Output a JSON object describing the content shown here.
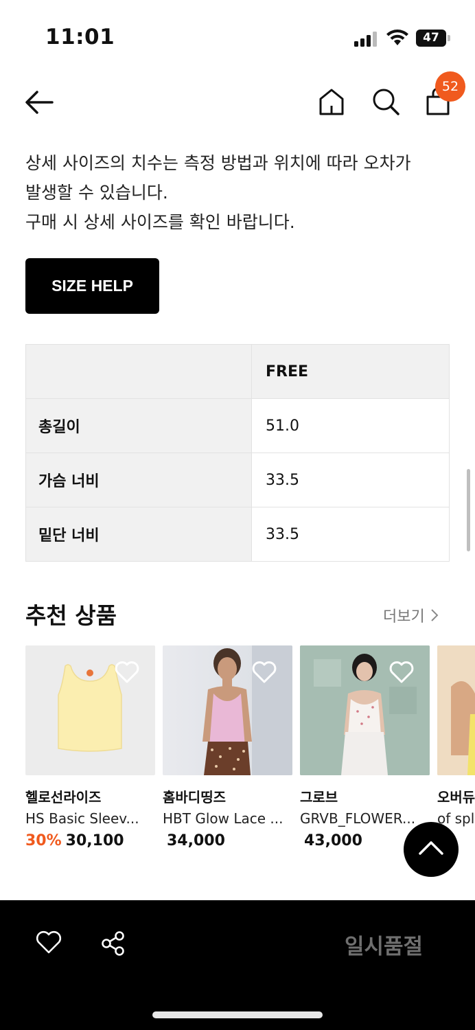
{
  "status": {
    "time": "11:01",
    "battery": "47"
  },
  "nav": {
    "cart_count": "52"
  },
  "notice_lines": [
    "상세 사이즈의 치수는 측정 방법과 위치에 따라 오차가",
    "발생할 수 있습니다.",
    "구매 시 상세 사이즈를 확인 바랍니다."
  ],
  "size_help_label": "SIZE HELP",
  "size_table": {
    "header": [
      "",
      "FREE"
    ],
    "rows": [
      {
        "label": "총길이",
        "value": "51.0"
      },
      {
        "label": "가슴 너비",
        "value": "33.5"
      },
      {
        "label": "밑단 너비",
        "value": "33.5"
      }
    ]
  },
  "recommend": {
    "title": "추천 상품",
    "more_label": "더보기",
    "products": [
      {
        "brand": "헬로선라이즈",
        "name": "HS Basic Sleev...",
        "discount": "30%",
        "price": "30,100"
      },
      {
        "brand": "홈바디띵즈",
        "name": "HBT Glow Lace ...",
        "discount": "",
        "price": "34,000"
      },
      {
        "brand": "그로브",
        "name": "GRVB_FLOWER...",
        "discount": "",
        "price": "43,000"
      },
      {
        "brand": "오버듀",
        "name": "of spli",
        "discount": "%",
        "price": ""
      }
    ]
  },
  "bottom_bar": {
    "status_label": "일시품절"
  },
  "icons": [
    "back-arrow-icon",
    "home-icon",
    "search-icon",
    "shopping-bag-icon",
    "heart-icon",
    "share-icon",
    "chevron-up-icon",
    "chevron-right-icon"
  ],
  "colors": {
    "accent": "#f05a1e",
    "button": "#000000",
    "table_header": "#f1f1f1"
  }
}
